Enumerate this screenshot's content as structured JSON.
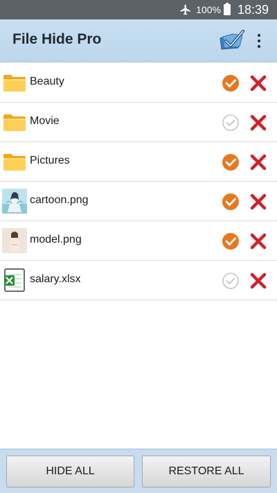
{
  "status_bar": {
    "battery": "100%",
    "time": "18:39",
    "icons": [
      "airplane-mode-icon",
      "battery-icon"
    ]
  },
  "toolbar": {
    "title": "File Hide Pro",
    "icons": [
      "mark-all-icon",
      "overflow-menu-icon"
    ]
  },
  "files": [
    {
      "name": "Beauty",
      "type": "folder",
      "hidden": true
    },
    {
      "name": "Movie",
      "type": "folder",
      "hidden": false
    },
    {
      "name": "Pictures",
      "type": "folder",
      "hidden": true
    },
    {
      "name": "cartoon.png",
      "type": "image",
      "hidden": true
    },
    {
      "name": "model.png",
      "type": "image",
      "hidden": true
    },
    {
      "name": "salary.xlsx",
      "type": "excel",
      "hidden": false
    }
  ],
  "buttons": {
    "hide_all": "HIDE ALL",
    "restore_all": "RESTORE ALL"
  },
  "colors": {
    "toolbar_bg": "#c9dff1",
    "check_active": "#e8771e",
    "check_inactive": "#bdbdbd",
    "delete": "#d0202a"
  }
}
